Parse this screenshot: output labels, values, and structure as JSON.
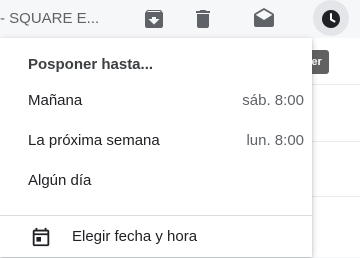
{
  "toolbar": {
    "subject": "- SQUARE E...",
    "icons": [
      "archive-icon",
      "delete-icon",
      "mark-read-icon",
      "snooze-icon"
    ]
  },
  "tooltip": {
    "text": "Posponer"
  },
  "snooze_menu": {
    "title": "Posponer hasta...",
    "items": [
      {
        "label": "Mañana",
        "time": "sáb. 8:00"
      },
      {
        "label": "La próxima semana",
        "time": "lun. 8:00"
      },
      {
        "label": "Algún día",
        "time": ""
      }
    ],
    "custom": {
      "label": "Elegir fecha y hora",
      "icon": "calendar-icon"
    }
  }
}
